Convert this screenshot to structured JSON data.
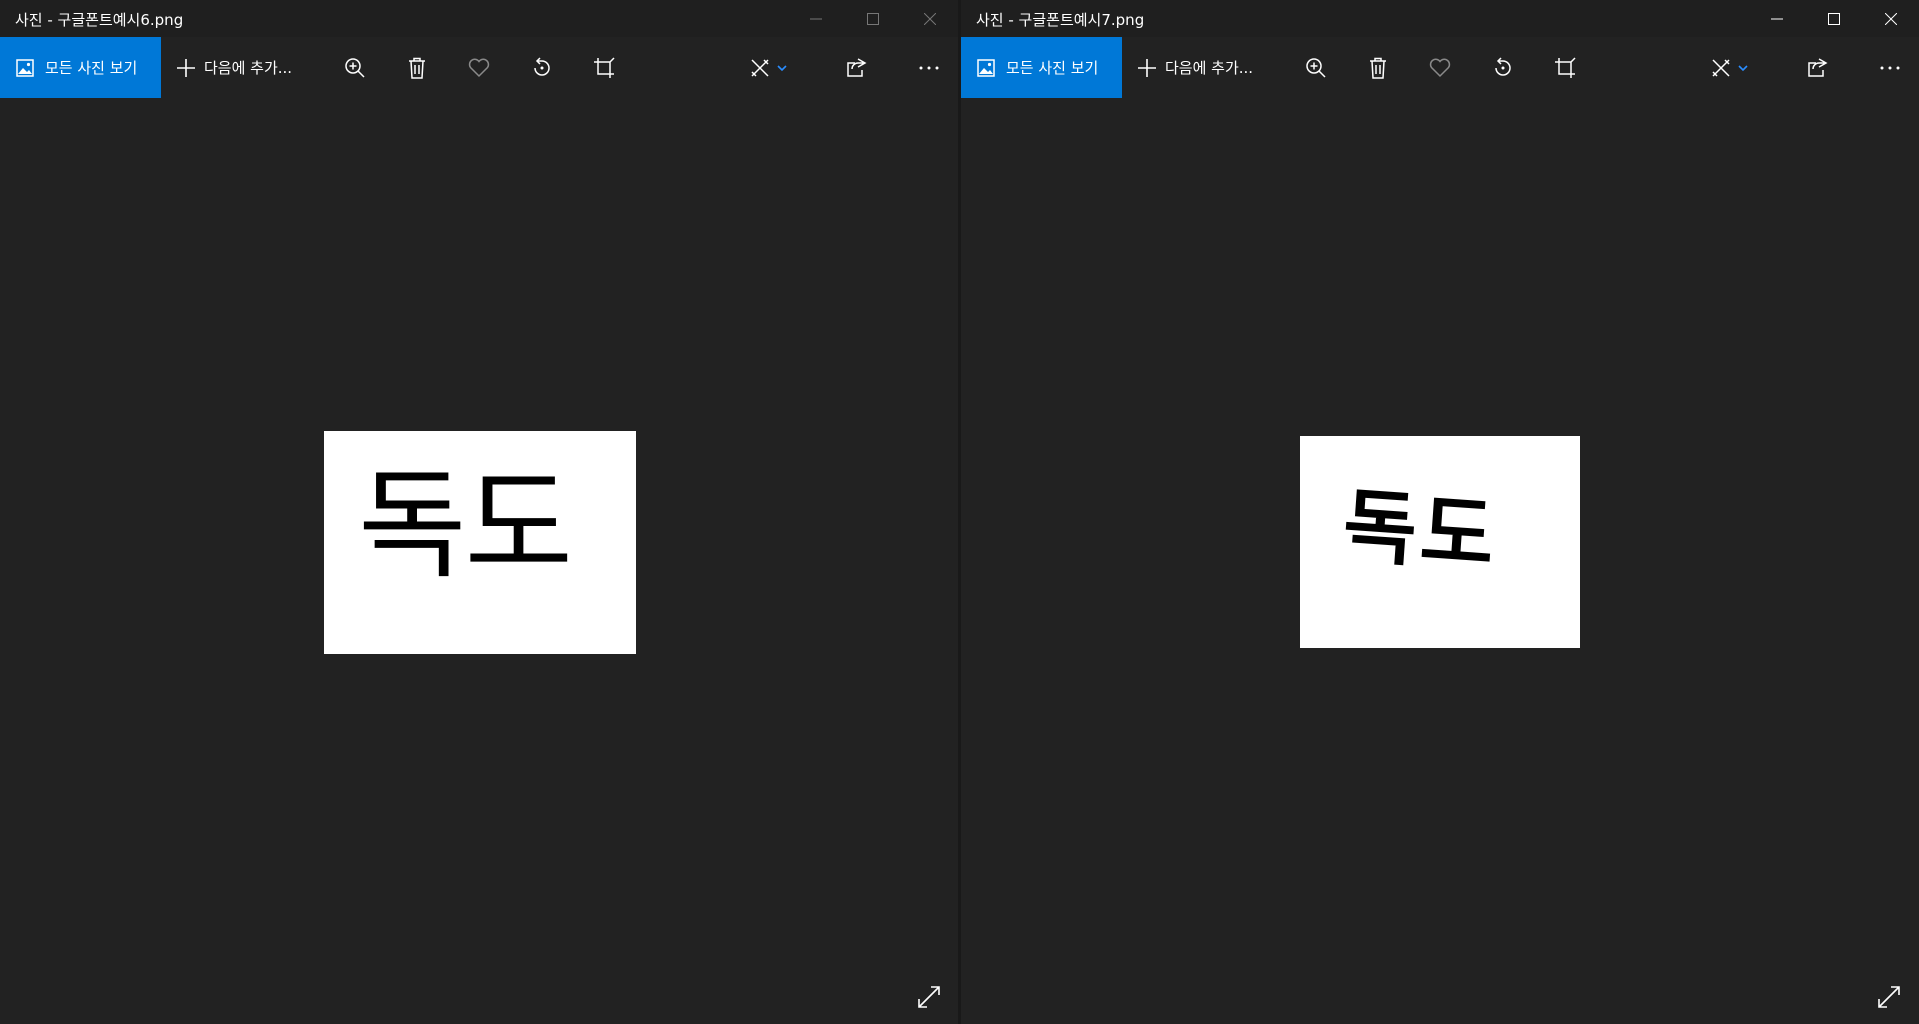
{
  "windows": [
    {
      "title": "사진 - 구글폰트예시6.png",
      "toolbar": {
        "view_all_label": "모든 사진 보기",
        "add_to_label": "다음에 추가..."
      },
      "image_text": "독도"
    },
    {
      "title": "사진 - 구글폰트예시7.png",
      "toolbar": {
        "view_all_label": "모든 사진 보기",
        "add_to_label": "다음에 추가..."
      },
      "image_text": "독도"
    }
  ],
  "icons": {
    "view_all": "photos-icon",
    "add": "plus-icon",
    "zoom": "zoom-in-icon",
    "delete": "trash-icon",
    "favorite": "heart-icon",
    "rotate": "rotate-icon",
    "crop": "crop-icon",
    "edit": "edit-create-icon",
    "share": "share-icon",
    "more": "more-icon",
    "fullscreen": "expand-icon"
  },
  "colors": {
    "accent": "#0078d7",
    "background": "#222222",
    "titlebar": "#1f1f1f"
  }
}
